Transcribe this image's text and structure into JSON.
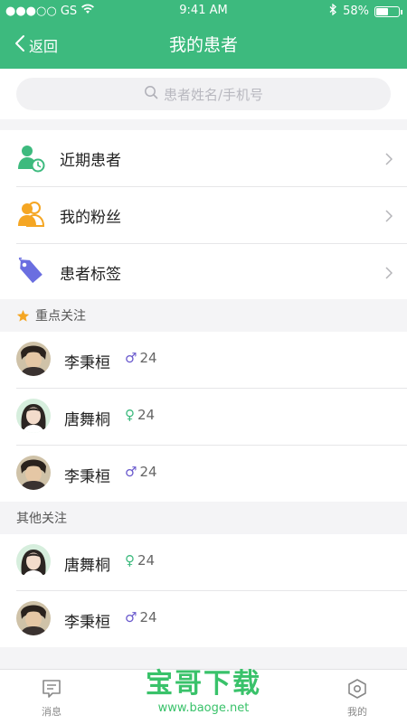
{
  "status_bar": {
    "carrier": "●●●○○ GS",
    "time": "9:41 AM",
    "battery": "58%",
    "battery_level": 0.58
  },
  "nav": {
    "back_label": "返回",
    "title": "我的患者"
  },
  "search": {
    "placeholder": "患者姓名/手机号"
  },
  "menu": [
    {
      "label": "近期患者",
      "icon": "recent-patient-icon",
      "color": "#3dba7e"
    },
    {
      "label": "我的粉丝",
      "icon": "fans-icon",
      "color": "#f5a623"
    },
    {
      "label": "患者标签",
      "icon": "tag-icon",
      "color": "#6a6ee0"
    }
  ],
  "sections": {
    "key": {
      "title": "重点关注",
      "star_color": "#f5a623"
    },
    "other": {
      "title": "其他关注"
    }
  },
  "key_patients": [
    {
      "name": "李秉桓",
      "gender": "male",
      "gender_symbol": "♂",
      "age": "24"
    },
    {
      "name": "唐舞桐",
      "gender": "female",
      "gender_symbol": "♀",
      "age": "24"
    },
    {
      "name": "李秉桓",
      "gender": "male",
      "gender_symbol": "♂",
      "age": "24"
    }
  ],
  "other_patients": [
    {
      "name": "唐舞桐",
      "gender": "female",
      "gender_symbol": "♀",
      "age": "24"
    },
    {
      "name": "李秉桓",
      "gender": "male",
      "gender_symbol": "♂",
      "age": "24"
    }
  ],
  "tabbar": {
    "messages": "消息",
    "mine": "我的"
  },
  "watermark": {
    "logo": "宝哥下载",
    "url": "www.baoge.net"
  },
  "colors": {
    "primary": "#3dba7e",
    "male": "#6a5acd",
    "female": "#3dba7e"
  }
}
